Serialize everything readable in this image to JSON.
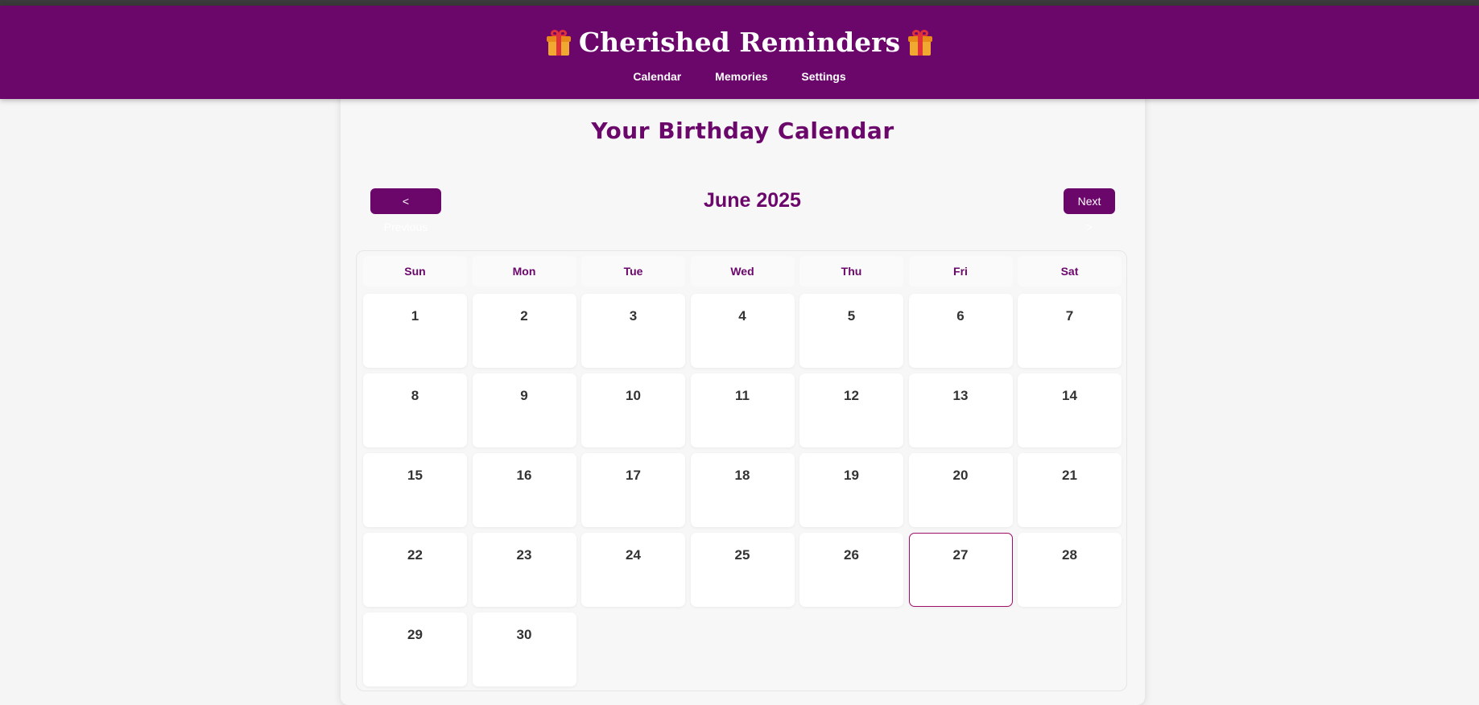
{
  "app": {
    "title": "Cherished Reminders",
    "accent_color": "#6b066b",
    "brand_icon": "gift-icon"
  },
  "nav": {
    "items": [
      "Calendar",
      "Memories",
      "Settings"
    ]
  },
  "calendar": {
    "title": "Your Birthday Calendar",
    "prev_label": "< Previous",
    "next_label": "Next >",
    "month_label": "June 2025",
    "weekdays": [
      "Sun",
      "Mon",
      "Tue",
      "Wed",
      "Thu",
      "Fri",
      "Sat"
    ],
    "days": [
      "1",
      "2",
      "3",
      "4",
      "5",
      "6",
      "7",
      "8",
      "9",
      "10",
      "11",
      "12",
      "13",
      "14",
      "15",
      "16",
      "17",
      "18",
      "19",
      "20",
      "21",
      "22",
      "23",
      "24",
      "25",
      "26",
      "27",
      "28",
      "29",
      "30"
    ],
    "highlighted_day": "27",
    "highlight_color": "#a0106a"
  }
}
